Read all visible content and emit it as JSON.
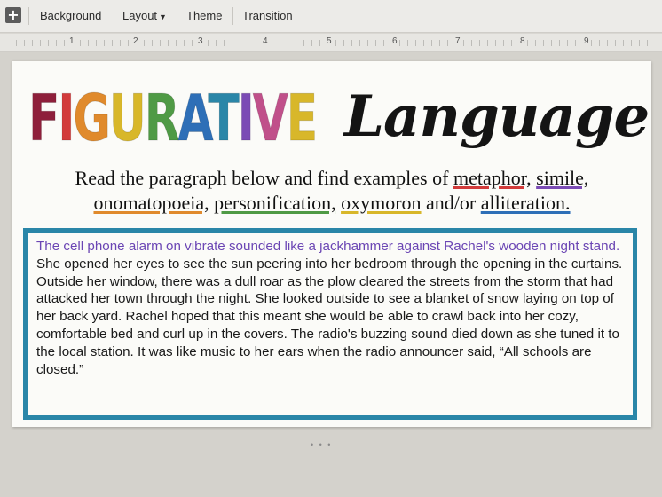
{
  "toolbar": {
    "add_icon": "plus-icon",
    "background": "Background",
    "layout": "Layout",
    "theme": "Theme",
    "transition": "Transition"
  },
  "ruler": {
    "numbers": [
      "1",
      "2",
      "3",
      "4",
      "5",
      "6",
      "7",
      "8",
      "9"
    ]
  },
  "slide": {
    "title_part1": "FIGURATIVE",
    "title_part2": "Language",
    "title_colors": [
      "#8e1f3b",
      "#d23b3b",
      "#e08a2c",
      "#d8b72a",
      "#4f9a45",
      "#2e6fb7",
      "#2a86a8",
      "#7b4bb5",
      "#c0508a",
      "#d8b72a"
    ],
    "instruction": {
      "prefix": "Read the paragraph below and find examples of ",
      "metaphor": "metaphor,",
      "simile": "simile,",
      "onomatopoeia": "onomatopoeia,",
      "personification": "personification,",
      "oxymoron": "oxymoron",
      "and_or": " and/or ",
      "alliteration": "alliteration."
    },
    "passage": {
      "highlight": "The cell phone alarm on vibrate sounded like a jackhammer against Rachel's wooden night stand.",
      "rest": "  She opened her eyes to see the sun peering into her bedroom through the opening in the curtains. Outside her window, there was a dull roar as the plow cleared the streets from the storm that had attacked her town through the night.  She looked outside to see a blanket of snow laying on top of her back yard.  Rachel hoped that this meant she would be able to crawl back into her cozy, comfortable bed and curl up in the covers. The radio's buzzing sound died down as she tuned it to the local station.  It was like music to her ears when the radio announcer said, “All schools are closed.”"
    }
  }
}
